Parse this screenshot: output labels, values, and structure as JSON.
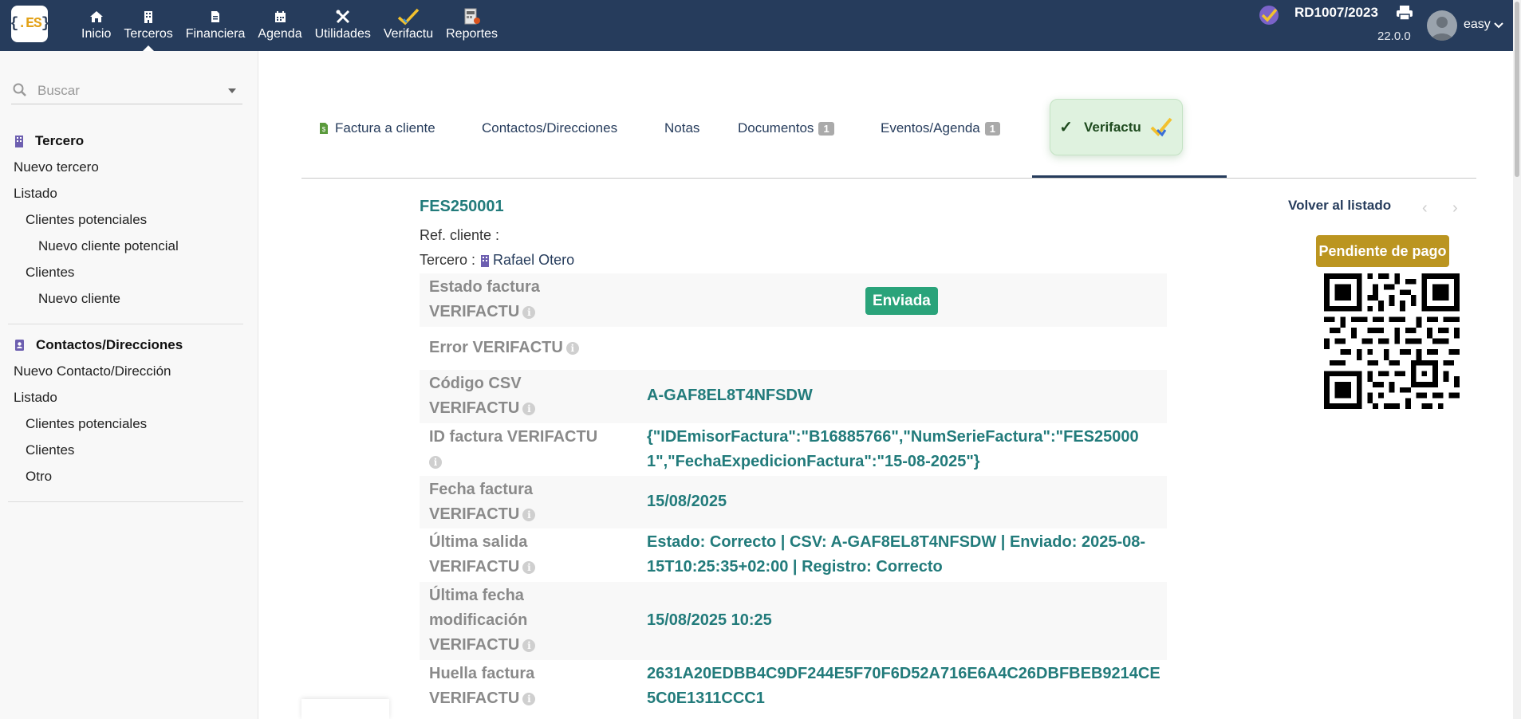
{
  "app": {
    "logo_text": ".ES"
  },
  "topnav": {
    "items": [
      {
        "label": "Inicio",
        "icon": "home-icon"
      },
      {
        "label": "Terceros",
        "icon": "building-icon"
      },
      {
        "label": "Financiera",
        "icon": "document-icon"
      },
      {
        "label": "Agenda",
        "icon": "calendar-icon"
      },
      {
        "label": "Utilidades",
        "icon": "tools-icon"
      },
      {
        "label": "Verifactu",
        "icon": "verifactu-check-icon"
      },
      {
        "label": "Reportes",
        "icon": "report-icon"
      }
    ],
    "active": "Terceros",
    "company_ref": "RD1007/2023",
    "version": "22.0.0",
    "user": "easy"
  },
  "sidebar": {
    "search_placeholder": "Buscar",
    "tercero": {
      "title": "Tercero",
      "links": [
        "Nuevo tercero",
        "Listado",
        "Clientes potenciales",
        "Nuevo cliente potencial",
        "Clientes",
        "Nuevo cliente"
      ]
    },
    "contactos": {
      "title": "Contactos/Direcciones",
      "links": [
        "Nuevo Contacto/Dirección",
        "Listado",
        "Clientes potenciales",
        "Clientes",
        "Otro"
      ]
    }
  },
  "tabs": {
    "factura": "Factura a cliente",
    "contactos": "Contactos/Direcciones",
    "notas": "Notas",
    "documentos": "Documentos",
    "documentos_count": "1",
    "eventos": "Eventos/Agenda",
    "eventos_count": "1",
    "verifactu": "Verifactu"
  },
  "invoice": {
    "ref": "FES250001",
    "ref_cliente_label": "Ref. cliente :",
    "tercero_label": "Tercero :",
    "tercero_name": "Rafael Otero",
    "back_link": "Volver al listado",
    "status": "Pendiente de pago"
  },
  "fields": {
    "estado_label_1": "Estado factura",
    "estado_label_2": "VERIFACTU",
    "estado_value": "Enviada",
    "error_label": "Error VERIFACTU",
    "csv_label_1": "Código CSV",
    "csv_label_2": "VERIFACTU",
    "csv_value": "A-GAF8EL8T4NFSDW",
    "id_label": "ID factura VERIFACTU",
    "id_value": "{\"IDEmisorFactura\":\"B16885766\",\"NumSerieFactura\":\"FES250001\",\"FechaExpedicionFactura\":\"15-08-2025\"}",
    "fecha_label_1": "Fecha factura",
    "fecha_label_2": "VERIFACTU",
    "fecha_value": "15/08/2025",
    "salida_label_1": "Última salida",
    "salida_label_2": "VERIFACTU",
    "salida_value": "Estado: Correcto | CSV: A-GAF8EL8T4NFSDW | Enviado: 2025-08-15T10:25:35+02:00 | Registro: Correcto",
    "mod_label_1": "Última fecha",
    "mod_label_2": "modificación",
    "mod_label_3": "VERIFACTU",
    "mod_value": "15/08/2025 10:25",
    "huella_label_1": "Huella factura",
    "huella_label_2": "VERIFACTU",
    "huella_value": "2631A20EDBB4C9DF244E5F70F6D52A716E6A4C26DBFBEB9214CE5C0E1311CCC1"
  },
  "colors": {
    "topbar": "#263c5c",
    "value_teal": "#227b7b",
    "status_gold": "#bb9520",
    "sent_green": "#2aa37a"
  }
}
